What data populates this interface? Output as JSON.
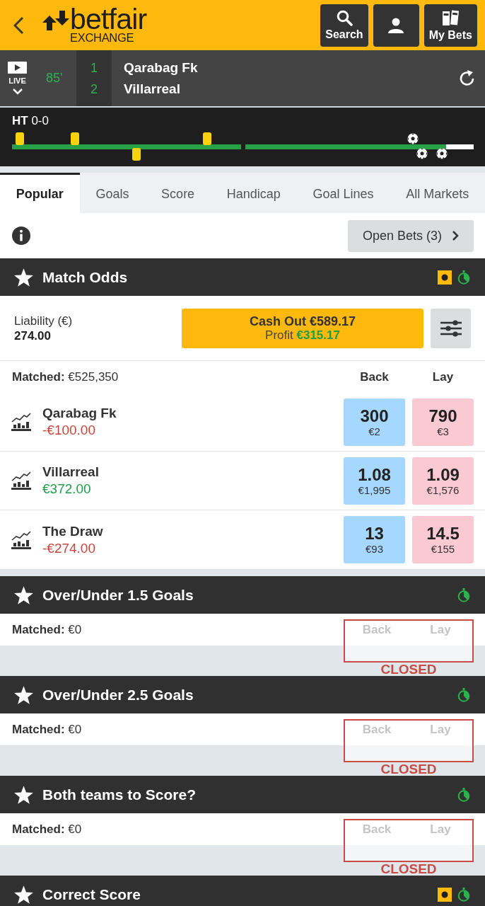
{
  "header": {
    "logo_text": "betfair",
    "logo_subtext": "EXCHANGE",
    "buttons": [
      {
        "kind": "search",
        "label": "Search"
      },
      {
        "kind": "account"
      },
      {
        "kind": "bets",
        "label": "My Bets"
      }
    ]
  },
  "scoreboard": {
    "live_label": "LIVE",
    "minute": "85'",
    "teams": [
      {
        "name": "Qarabag Fk",
        "score": "1"
      },
      {
        "name": "Villarreal",
        "score": "2"
      }
    ]
  },
  "timeline": {
    "half_time": "**HT** 0-0",
    "halves": [
      {
        "level": 1,
        "events": [
          {
            "kind": "card",
            "home": true,
            "level": 0.034
          },
          {
            "kind": "card",
            "home": true,
            "level": 0.274
          },
          {
            "kind": "card",
            "home": false,
            "level": 0.545
          },
          {
            "kind": "card",
            "home": true,
            "level": 0.854
          }
        ]
      },
      {
        "level": 0.88,
        "events": [
          {
            "kind": "goal",
            "home": true,
            "level": 0.733
          },
          {
            "kind": "goal",
            "home": false,
            "level": 0.773
          },
          {
            "kind": "goal",
            "home": false,
            "level": 0.862
          }
        ]
      }
    ]
  },
  "tabs": [
    {
      "label": "Popular",
      "selected": true
    },
    {
      "label": "Goals",
      "selected": false
    },
    {
      "label": "Score",
      "selected": false
    },
    {
      "label": "Handicap",
      "selected": false
    },
    {
      "label": "Goal Lines",
      "selected": false
    },
    {
      "label": "All Markets",
      "selected": false
    }
  ],
  "open_bets": {
    "label": "Open Bets (3)"
  },
  "markets": [
    {
      "title": "Match Odds",
      "in_play": true,
      "closed": false,
      "liability_label": "Liability (€)",
      "liability": "274.00",
      "cash_out": {
        "label": "Cash Out €589.17",
        "profit_label": "Profit",
        "profit": "€315.17"
      },
      "matched": "**Matched:** €525,350",
      "back_label": "Back",
      "lay_label": "Lay",
      "runners": [
        {
          "name": "Qarabag Fk",
          "pnl": "-€100.00",
          "positive": false,
          "back": {
            "price": "300",
            "size": "€2"
          },
          "lay": {
            "price": "790",
            "size": "€3"
          }
        },
        {
          "name": "Villarreal",
          "pnl": "€372.00",
          "positive": true,
          "back": {
            "price": "1.08",
            "size": "€1,995"
          },
          "lay": {
            "price": "1.09",
            "size": "€1,576"
          }
        },
        {
          "name": "The Draw",
          "pnl": "-€274.00",
          "positive": false,
          "back": {
            "price": "13",
            "size": "€93"
          },
          "lay": {
            "price": "14.5",
            "size": "€155"
          }
        }
      ]
    },
    {
      "title": "Over/Under 1.5 Goals",
      "in_play": false,
      "closed": true,
      "matched": "**Matched:** €0",
      "back_label": "Back",
      "lay_label": "Lay",
      "closed_label": "CLOSED"
    },
    {
      "title": "Over/Under 2.5 Goals",
      "in_play": false,
      "closed": true,
      "matched": "**Matched:** €0",
      "back_label": "Back",
      "lay_label": "Lay",
      "closed_label": "CLOSED"
    },
    {
      "title": "Both teams to Score?",
      "in_play": false,
      "closed": true,
      "matched": "**Matched:** €0",
      "back_label": "Back",
      "lay_label": "Lay",
      "closed_label": "CLOSED"
    },
    {
      "title": "Correct Score",
      "in_play": true
    }
  ]
}
